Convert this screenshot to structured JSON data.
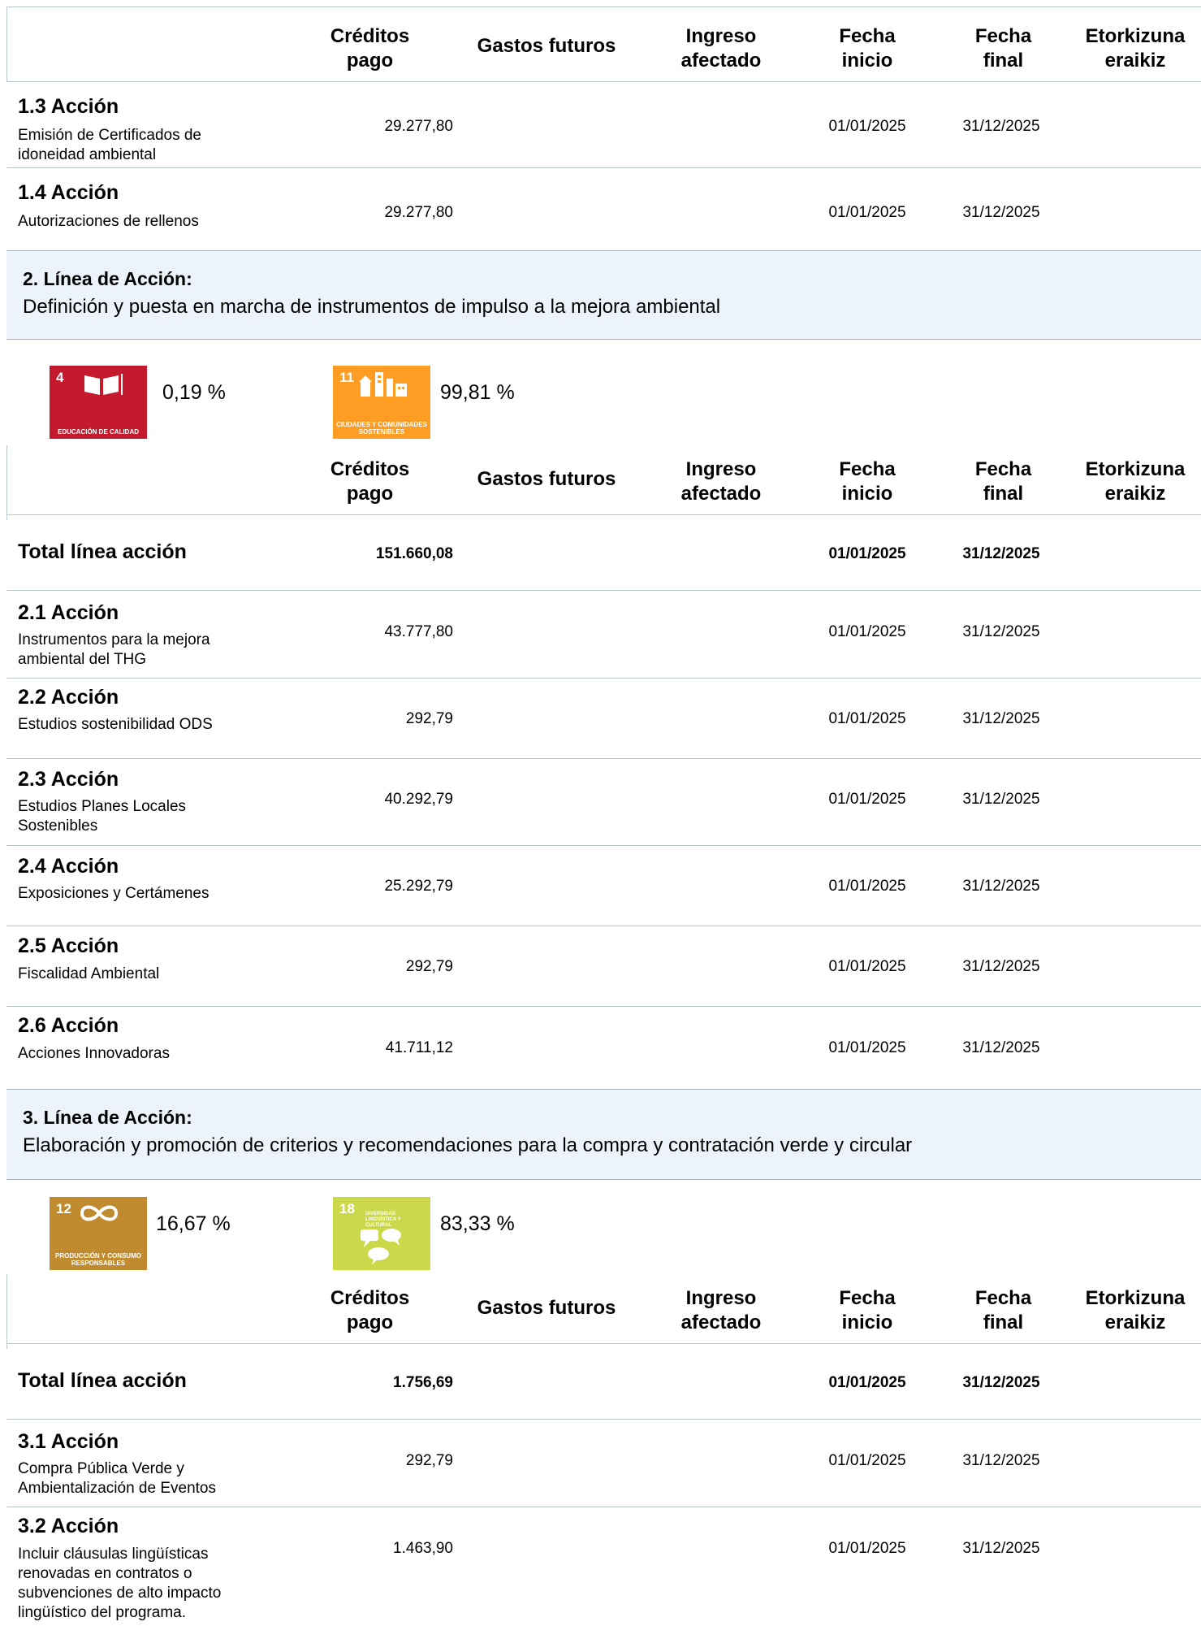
{
  "headers": {
    "creditos": "Créditos\npago",
    "gastos": "Gastos futuros",
    "ingreso": "Ingreso\nafectado",
    "fecha_inicio": "Fecha\ninicio",
    "fecha_final": "Fecha\nfinal",
    "etorkizuna": "Etorkizuna\neraikiz"
  },
  "section1": {
    "actions": [
      {
        "title": "1.3 Acción",
        "desc": "Emisión de Certificados de idoneidad ambiental",
        "creditos": "29.277,80",
        "inicio": "01/01/2025",
        "final": "31/12/2025"
      },
      {
        "title": "1.4 Acción",
        "desc": "Autorizaciones de rellenos",
        "creditos": "29.277,80",
        "inicio": "01/01/2025",
        "final": "31/12/2025"
      }
    ]
  },
  "line2": {
    "title": "2. Línea de Acción:",
    "desc": "Definición y puesta en marcha de instrumentos de impulso a la mejora ambiental",
    "ods": [
      {
        "number": "4",
        "label": "Educación de calidad",
        "color": "#c5192d",
        "icon": "book-icon",
        "percent": "0,19 %"
      },
      {
        "number": "11",
        "label": "Ciudades y comunidades sostenibles",
        "color": "#fd9d24",
        "icon": "city-icon",
        "percent": "99,81 %"
      }
    ],
    "total": {
      "label": "Total línea acción",
      "creditos": "151.660,08",
      "inicio": "01/01/2025",
      "final": "31/12/2025"
    },
    "actions": [
      {
        "title": "2.1 Acción",
        "desc": "Instrumentos para la mejora ambiental del THG",
        "creditos": "43.777,80",
        "inicio": "01/01/2025",
        "final": "31/12/2025"
      },
      {
        "title": "2.2 Acción",
        "desc": "Estudios sostenibilidad ODS",
        "creditos": "292,79",
        "inicio": "01/01/2025",
        "final": "31/12/2025"
      },
      {
        "title": "2.3 Acción",
        "desc": "Estudios Planes Locales Sostenibles",
        "creditos": "40.292,79",
        "inicio": "01/01/2025",
        "final": "31/12/2025"
      },
      {
        "title": "2.4 Acción",
        "desc": "Exposiciones y Certámenes",
        "creditos": "25.292,79",
        "inicio": "01/01/2025",
        "final": "31/12/2025"
      },
      {
        "title": "2.5 Acción",
        "desc": "Fiscalidad Ambiental",
        "creditos": "292,79",
        "inicio": "01/01/2025",
        "final": "31/12/2025"
      },
      {
        "title": "2.6 Acción",
        "desc": "Acciones Innovadoras",
        "creditos": "41.711,12",
        "inicio": "01/01/2025",
        "final": "31/12/2025"
      }
    ]
  },
  "line3": {
    "title": "3. Línea de Acción:",
    "desc": "Elaboración y promoción de criterios y recomendaciones para la compra y contratación verde y circular",
    "ods": [
      {
        "number": "12",
        "label": "Producción y consumo responsables",
        "color": "#bf8b2e",
        "icon": "infinity-icon",
        "percent": "16,67 %"
      },
      {
        "number": "18",
        "label": "Diversidad lingüística y cultural",
        "color": "#cbd84a",
        "icon": "speech-bubbles-icon",
        "percent": "83,33 %"
      }
    ],
    "total": {
      "label": "Total línea acción",
      "creditos": "1.756,69",
      "inicio": "01/01/2025",
      "final": "31/12/2025"
    },
    "actions": [
      {
        "title": "3.1 Acción",
        "desc": "Compra Pública Verde y Ambientalización de Eventos",
        "creditos": "292,79",
        "inicio": "01/01/2025",
        "final": "31/12/2025"
      },
      {
        "title": "3.2 Acción",
        "desc": "Incluir cláusulas lingüísticas renovadas en contratos o subvenciones de alto impacto lingüístico del programa.",
        "creditos": "1.463,90",
        "inicio": "01/01/2025",
        "final": "31/12/2025"
      }
    ]
  }
}
